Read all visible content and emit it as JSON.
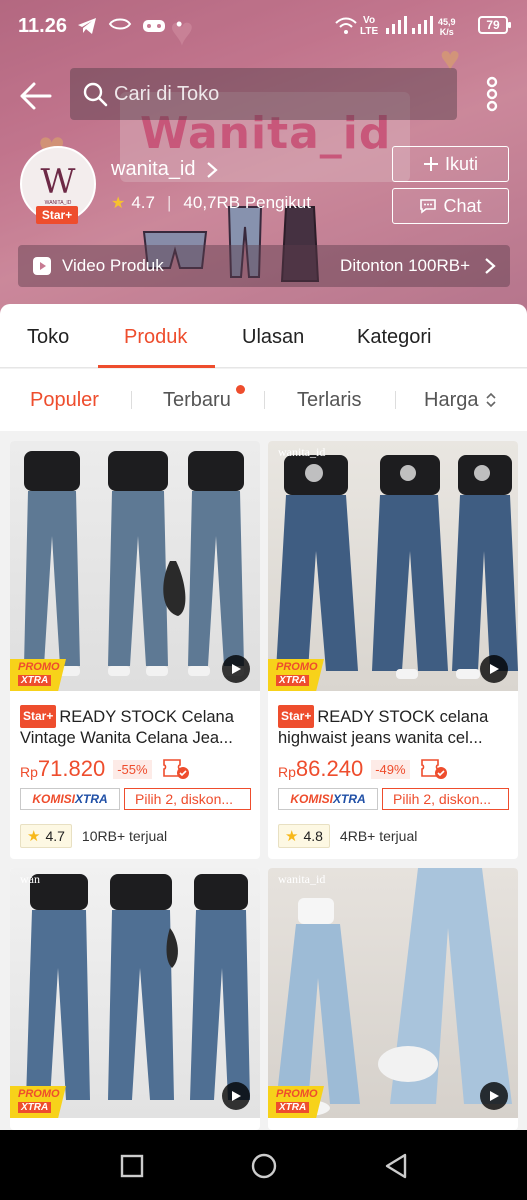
{
  "status_bar": {
    "time": "11.26",
    "net_speed_top": "45,9",
    "net_speed_bottom": "K/s",
    "lte_top": "Vo",
    "lte_bottom": "LTE",
    "battery": "79"
  },
  "header": {
    "search_placeholder": "Cari di Toko",
    "banner_text": "Wanita_id"
  },
  "shop": {
    "name": "wanita_id",
    "avatar_letter": "W",
    "avatar_subtext": "WANITA_ID",
    "badge": "Star+",
    "rating": "4.7",
    "followers": "40,7RB Pengikut",
    "follow_label": "Ikuti",
    "chat_label": "Chat",
    "video_label": "Video Produk",
    "video_views": "Ditonton 100RB+"
  },
  "main_tabs": [
    {
      "label": "Toko",
      "active": false
    },
    {
      "label": "Produk",
      "active": true
    },
    {
      "label": "Ulasan",
      "active": false
    },
    {
      "label": "Kategori",
      "active": false
    }
  ],
  "sort": [
    {
      "label": "Populer",
      "active": true
    },
    {
      "label": "Terbaru",
      "active": false
    },
    {
      "label": "Terlaris",
      "active": false
    },
    {
      "label": "Harga",
      "active": false
    }
  ],
  "products": [
    {
      "badge": "Star+",
      "title_line1": "READY STOCK Celana",
      "title_line2": "Vintage Wanita Celana Jea...",
      "currency": "Rp",
      "price": "71.820",
      "discount": "-55%",
      "komisi_a": "KOMISI",
      "komisi_b": "XTRA",
      "promo": "Pilih 2, diskon...",
      "rating": "4.7",
      "sold": "10RB+ terjual",
      "promo_top": "PROMO",
      "promo_bottom": "XTRA"
    },
    {
      "badge": "Star+",
      "title_line1": "READY STOCK celana",
      "title_line2": "highwaist jeans wanita cel...",
      "currency": "Rp",
      "price": "86.240",
      "discount": "-49%",
      "komisi_a": "KOMISI",
      "komisi_b": "XTRA",
      "promo": "Pilih 2, diskon...",
      "rating": "4.8",
      "sold": "4RB+ terjual",
      "promo_top": "PROMO",
      "promo_bottom": "XTRA",
      "watermark": "wanita_id"
    },
    {
      "promo_top": "PROMO",
      "promo_bottom": "XTRA",
      "watermark": "wan"
    },
    {
      "promo_top": "PROMO",
      "promo_bottom": "XTRA",
      "watermark": "wanita_id"
    }
  ],
  "colors": {
    "accent": "#ee4d2d",
    "star": "#f7c12f",
    "promo_yellow": "#f7d21a"
  }
}
